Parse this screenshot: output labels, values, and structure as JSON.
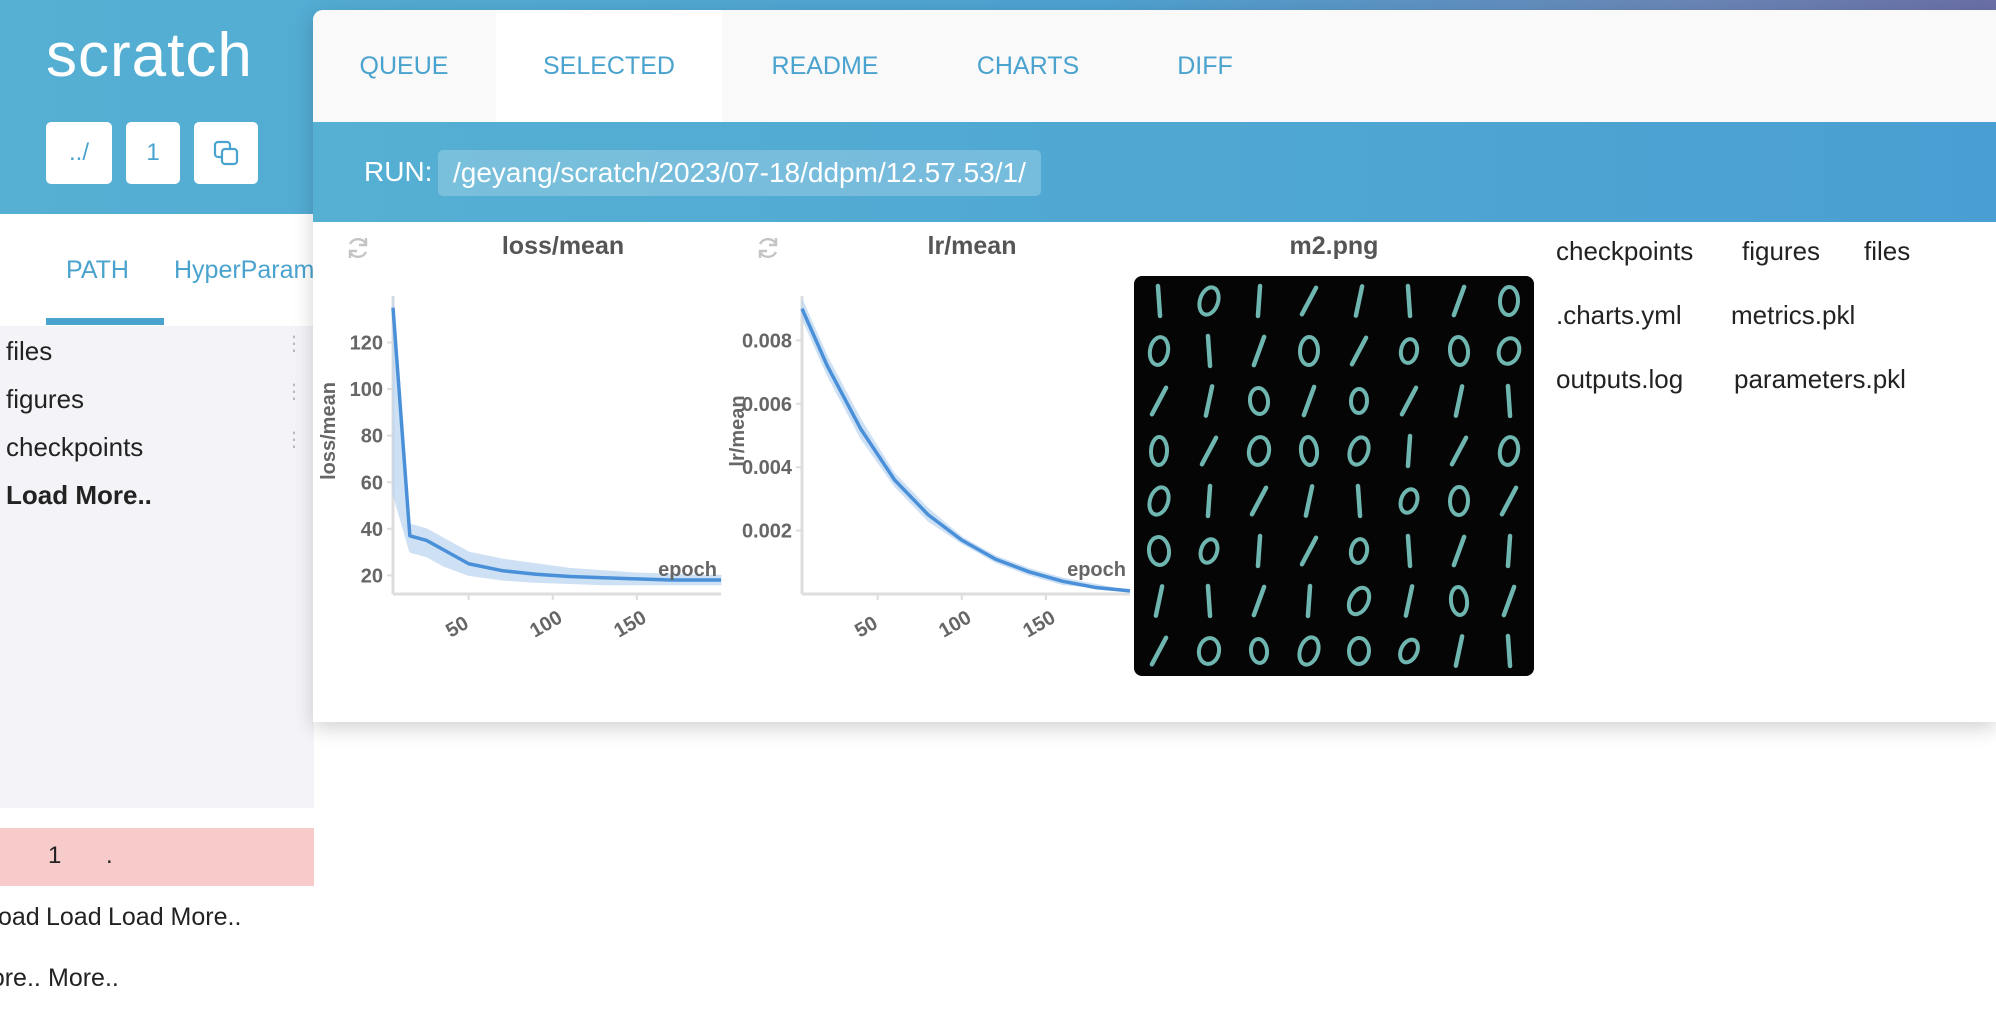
{
  "app": {
    "title": "scratch"
  },
  "nav_buttons": {
    "up": "../",
    "count": "1",
    "copy_icon": "copy-icon"
  },
  "sidebar": {
    "tabs": [
      "PATH",
      "HyperParam"
    ],
    "items": [
      "files",
      "figures",
      "checkpoints"
    ],
    "load_more": "Load More..",
    "row": {
      "index": "1",
      "dot": "."
    },
    "bottom_line1": [
      "oad",
      "Load",
      "Load More.."
    ],
    "bottom_line2": [
      "More..",
      "More.."
    ]
  },
  "tabs": [
    "QUEUE",
    "SELECTED",
    "README",
    "CHARTS",
    "DIFF"
  ],
  "active_tab": "SELECTED",
  "run": {
    "label": "RUN:",
    "path": "/geyang/scratch/2023/07-18/ddpm/12.57.53/1/"
  },
  "chart_data": [
    {
      "type": "line",
      "title": "loss/mean",
      "xlabel": "epoch",
      "ylabel": "loss/mean",
      "xlim": [
        5,
        200
      ],
      "ylim": [
        12,
        140
      ],
      "xticks": [
        "50",
        "100",
        "150"
      ],
      "yticks": [
        "20",
        "40",
        "60",
        "80",
        "100",
        "120"
      ],
      "series": [
        {
          "x": [
            5,
            15,
            25,
            35,
            50,
            70,
            90,
            110,
            130,
            150,
            170,
            190,
            200
          ],
          "y": [
            135,
            37,
            35,
            31,
            25,
            22,
            20.5,
            19.5,
            19,
            18.5,
            18,
            18,
            18
          ],
          "band_low": [
            55,
            30,
            28,
            24,
            20,
            18,
            17,
            16.5,
            16,
            16,
            16,
            16,
            16
          ],
          "band_high": [
            140,
            42,
            40,
            36,
            30,
            27,
            25,
            23,
            22,
            21,
            20.5,
            20,
            20
          ]
        }
      ],
      "grid": false
    },
    {
      "type": "line",
      "title": "lr/mean",
      "xlabel": "epoch",
      "ylabel": "lr/mean",
      "xlim": [
        5,
        200
      ],
      "ylim": [
        0,
        0.0094
      ],
      "xticks": [
        "50",
        "100",
        "150"
      ],
      "yticks": [
        "0.002",
        "0.004",
        "0.006",
        "0.008"
      ],
      "series": [
        {
          "x": [
            5,
            20,
            40,
            60,
            80,
            100,
            120,
            140,
            160,
            180,
            200
          ],
          "y": [
            0.009,
            0.0072,
            0.0052,
            0.0036,
            0.0025,
            0.0017,
            0.0011,
            0.0007,
            0.0004,
            0.0002,
            0.0001
          ],
          "band_low": [
            0.0087,
            0.0069,
            0.0049,
            0.0034,
            0.0023,
            0.0016,
            0.001,
            0.0006,
            0.0003,
            0.0002,
            0.0001
          ],
          "band_high": [
            0.0093,
            0.0075,
            0.0055,
            0.0038,
            0.0027,
            0.0018,
            0.0012,
            0.0008,
            0.0005,
            0.0003,
            0.0001
          ]
        }
      ],
      "grid": false
    }
  ],
  "image": {
    "title": "m2.png",
    "digits": [
      "10111110",
      "01101000",
      "11010111",
      "01000110",
      "01111001",
      "00110111",
      "11110101",
      "10000011"
    ]
  },
  "files": [
    [
      "checkpoints",
      "figures",
      "files"
    ],
    [
      ".charts.yml",
      "metrics.pkl"
    ],
    [
      "outputs.log",
      "parameters.pkl"
    ]
  ],
  "colors": {
    "accent": "#4aa3cf",
    "line": "#4a90d9",
    "band": "#b9d4f0",
    "highlight_row": "#f8cbcb"
  }
}
